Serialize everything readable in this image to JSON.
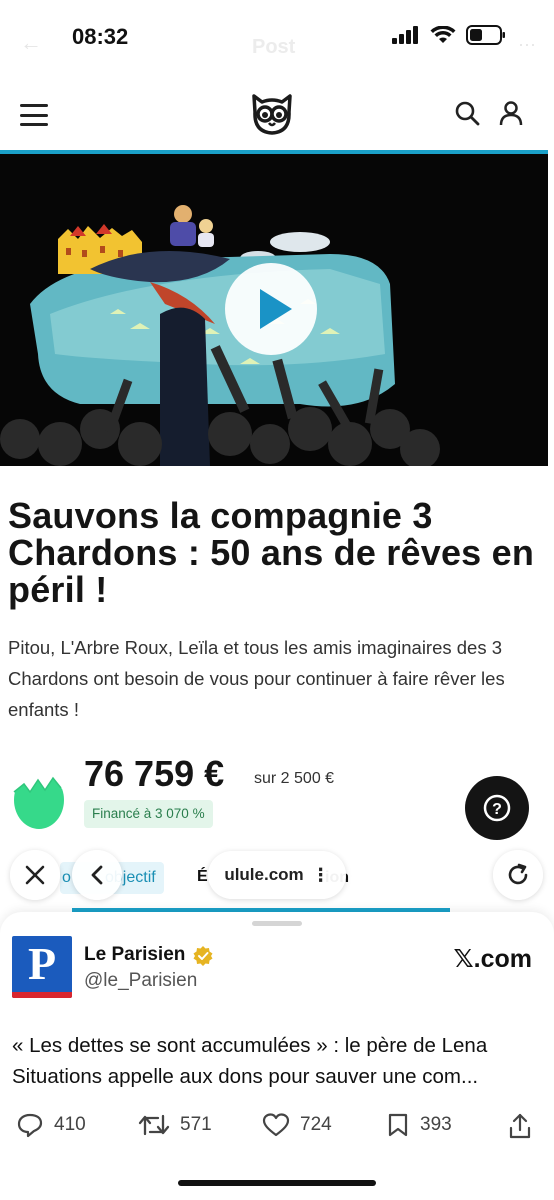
{
  "status_bar": {
    "time": "08:32",
    "ghost_title": "Post"
  },
  "site": {
    "logo_icon": "owl-logo-icon",
    "accent": "#1aa0c8"
  },
  "video": {
    "play_icon": "play-icon"
  },
  "project": {
    "title": "Sauvons la compagnie 3 Chardons : 50 ans de rêves en péril !",
    "description": "Pitou, L'Arbre Roux, Leïla et tous les amis imaginaires des 3 Chardons ont besoin de vous pour continuer à faire rêver les enfants !",
    "amount": "76 759 €",
    "goal": "sur 2 500 €",
    "funded_badge": "Financé à 3 070 %"
  },
  "tabs": {
    "objective": "objectif",
    "second_partial": "É",
    "third_partial": "ion",
    "objective_prefix": "o"
  },
  "browser": {
    "url": "ulule.com",
    "more": "⋮"
  },
  "tweet": {
    "account_name": "Le Parisien",
    "handle": "@le_Parisien",
    "avatar_letter": "P",
    "source": "𝕏.com",
    "text": "« Les dettes se sont accumulées » : le père de Lena Situations appelle aux dons pour sauver une com...",
    "replies": "410",
    "retweets": "571",
    "likes": "724",
    "bookmarks": "393"
  }
}
